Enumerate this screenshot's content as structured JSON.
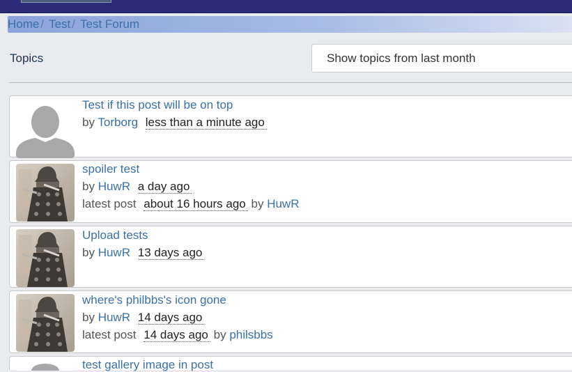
{
  "breadcrumb": {
    "items": [
      "Home",
      "Test",
      "Test Forum"
    ]
  },
  "topics_label": "Topics",
  "filter": {
    "selected": "Show topics from last month"
  },
  "topics": [
    {
      "title": "Test if this post will be on top",
      "by_label": "by",
      "author": "Torborg",
      "time": "less than a minute ago",
      "avatar_icon": "default-user-silhouette-icon"
    },
    {
      "title": "spoiler test",
      "by_label": "by",
      "author": "HuwR",
      "time": "a day ago",
      "latest_label": "latest post",
      "latest_time": "about 16 hours ago",
      "latest_by_label": "by",
      "latest_author": "HuwR",
      "avatar_icon": "dalek-avatar-icon"
    },
    {
      "title": "Upload tests",
      "by_label": "by",
      "author": "HuwR",
      "time": "13 days ago",
      "avatar_icon": "dalek-avatar-icon"
    },
    {
      "title": "where's philbbs's icon gone",
      "by_label": "by",
      "author": "HuwR",
      "time": "14 days ago",
      "latest_label": "latest post",
      "latest_time": "14 days ago",
      "latest_by_label": "by",
      "latest_author": "philsbbs",
      "avatar_icon": "dalek-avatar-icon"
    },
    {
      "title": "test gallery image in post",
      "avatar_icon": "default-user-silhouette-icon"
    }
  ],
  "colors": {
    "topbar": "#2b2a78",
    "link": "#3a71a8",
    "page_background": "#e9ebee"
  }
}
